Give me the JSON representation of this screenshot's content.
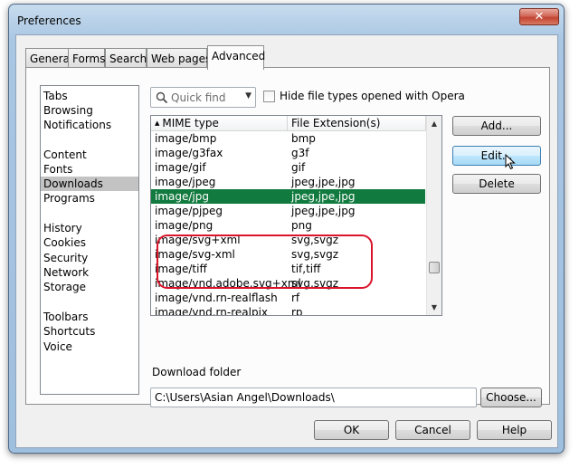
{
  "window": {
    "title": "Preferences",
    "close_glyph": "✕"
  },
  "tabs": [
    {
      "label": "General"
    },
    {
      "label": "Forms"
    },
    {
      "label": "Search"
    },
    {
      "label": "Web pages"
    },
    {
      "label": "Advanced",
      "active": true
    }
  ],
  "categories": {
    "items": [
      "Tabs",
      "Browsing",
      "Notifications",
      "Content",
      "Fonts",
      "Downloads",
      "Programs",
      "History",
      "Cookies",
      "Security",
      "Network",
      "Storage",
      "Toolbars",
      "Shortcuts",
      "Voice"
    ],
    "selected": "Downloads"
  },
  "quick_find": {
    "placeholder": "Quick find",
    "icon": "search-icon"
  },
  "hide_option": {
    "label": "Hide file types opened with Opera",
    "checked": false
  },
  "mime_table": {
    "columns": [
      "MIME type",
      "File Extension(s)"
    ],
    "rows": [
      {
        "type": "image/bmp",
        "ext": "bmp"
      },
      {
        "type": "image/g3fax",
        "ext": "g3f"
      },
      {
        "type": "image/gif",
        "ext": "gif"
      },
      {
        "type": "image/jpeg",
        "ext": "jpeg,jpe,jpg"
      },
      {
        "type": "image/jpg",
        "ext": "jpeg,jpe,jpg",
        "selected": true
      },
      {
        "type": "image/pjpeg",
        "ext": "jpeg,jpe,jpg"
      },
      {
        "type": "image/png",
        "ext": "png"
      },
      {
        "type": "image/svg+xml",
        "ext": "svg,svgz"
      },
      {
        "type": "image/svg-xml",
        "ext": "svg,svgz"
      },
      {
        "type": "image/tiff",
        "ext": "tif,tiff"
      },
      {
        "type": "image/vnd.adobe.svg+xml",
        "ext": "svg,svgz"
      },
      {
        "type": "image/vnd.rn-realflash",
        "ext": "rf"
      },
      {
        "type": "image/vnd.rn-realpix",
        "ext": "rp"
      }
    ],
    "selection_color": "#117a3e",
    "annotation_color": "#d9142b"
  },
  "actions": {
    "add": "Add...",
    "edit": "Edit...",
    "delete": "Delete"
  },
  "download_folder": {
    "label": "Download folder",
    "value": "C:\\Users\\Asian Angel\\Downloads\\",
    "choose": "Choose..."
  },
  "footer": {
    "ok": "OK",
    "cancel": "Cancel",
    "help": "Help"
  }
}
